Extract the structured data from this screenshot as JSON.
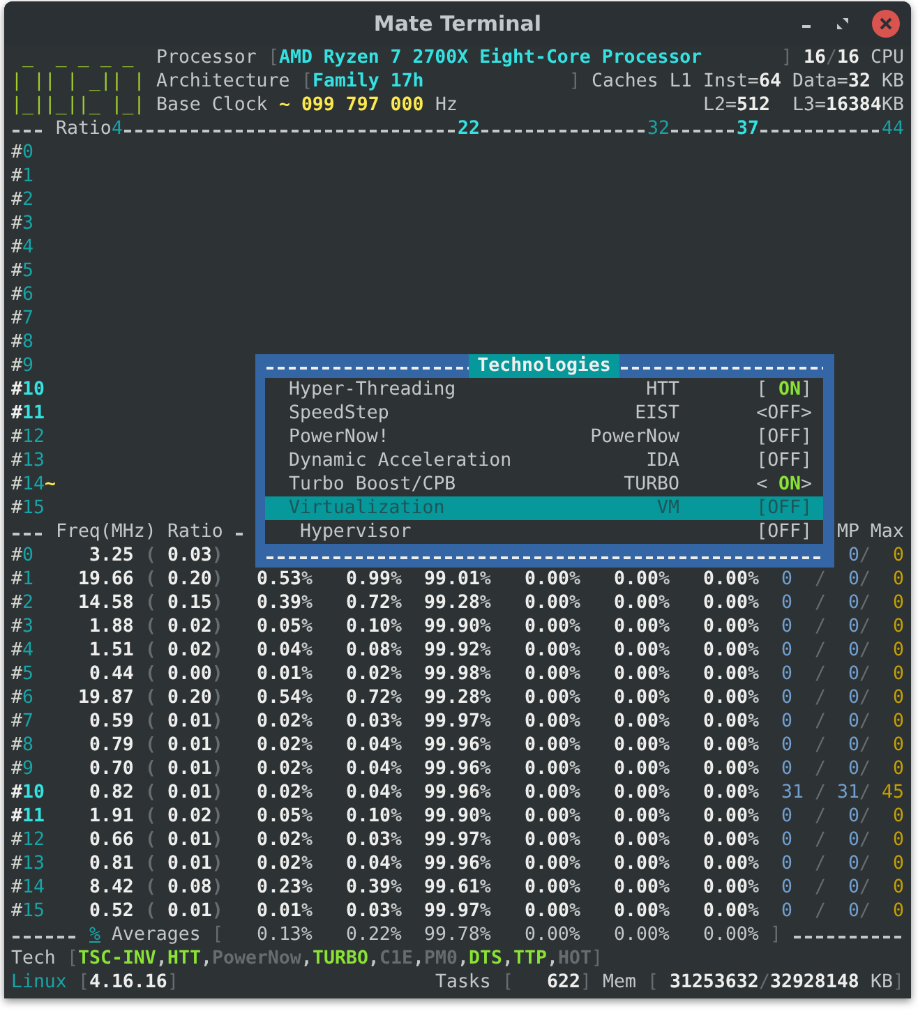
{
  "window": {
    "title": "Mate Terminal"
  },
  "header": {
    "logo": [
      " _  _ _ _ _",
      "| || | _|| |",
      "|_||_||_ |_|"
    ],
    "lines": [
      [
        {
          "text": "Processor",
          "kind": "label"
        },
        {
          "text": "[",
          "kind": "bracket"
        },
        {
          "text": "AMD Ryzen 7 2700X Eight-Core Processor",
          "kind": "value"
        },
        {
          "text": "]",
          "kind": "bracket"
        },
        {
          "text": "16",
          "kind": "number"
        },
        {
          "text": "/",
          "kind": "bracket"
        },
        {
          "text": "16",
          "kind": "number"
        },
        {
          "text": "CPU",
          "kind": "label"
        }
      ],
      [
        {
          "text": "Architecture",
          "kind": "label"
        },
        {
          "text": "[",
          "kind": "bracket"
        },
        {
          "text": "Family 17h",
          "kind": "value"
        },
        {
          "text": "]",
          "kind": "bracket"
        },
        {
          "text": "Caches L1",
          "kind": "label"
        },
        {
          "text": "Inst=",
          "kind": "label"
        },
        {
          "text": "64",
          "kind": "number"
        },
        {
          "text": "Data=",
          "kind": "label"
        },
        {
          "text": "32",
          "kind": "number"
        },
        {
          "text": "KB",
          "kind": "label"
        }
      ],
      [
        {
          "text": "Base Clock",
          "kind": "label"
        },
        {
          "text": "~ 099 797 000",
          "kind": "clock"
        },
        {
          "text": "Hz",
          "kind": "label"
        },
        {
          "text": "L2=",
          "kind": "label"
        },
        {
          "text": "512",
          "kind": "number"
        },
        {
          "text": "L3=",
          "kind": "label"
        },
        {
          "text": "16384",
          "kind": "number"
        },
        {
          "text": "KB",
          "kind": "label"
        }
      ]
    ]
  },
  "ratio_scale": {
    "label": "Ratio",
    "ticks": [
      {
        "text": "4",
        "bright": false
      },
      {
        "text": "22",
        "bright": true
      },
      {
        "text": "32",
        "bright": false
      },
      {
        "text": "37",
        "bright": true
      },
      {
        "text": "44",
        "bright": false
      }
    ]
  },
  "cores": [
    {
      "label": "#0",
      "active": false
    },
    {
      "label": "#1",
      "active": false
    },
    {
      "label": "#2",
      "active": false
    },
    {
      "label": "#3",
      "active": false
    },
    {
      "label": "#4",
      "active": false
    },
    {
      "label": "#5",
      "active": false
    },
    {
      "label": "#6",
      "active": false
    },
    {
      "label": "#7",
      "active": false
    },
    {
      "label": "#8",
      "active": false
    },
    {
      "label": "#9",
      "active": false
    },
    {
      "label": "#10",
      "active": true
    },
    {
      "label": "#11",
      "active": true
    },
    {
      "label": "#12",
      "active": false
    },
    {
      "label": "#13",
      "active": false
    },
    {
      "label": "#14",
      "active": false,
      "marker": "~"
    },
    {
      "label": "#15",
      "active": false
    }
  ],
  "freq_table": {
    "header": {
      "freq": "Freq(MHz)",
      "ratio": "Ratio",
      "tail": "MP Max"
    },
    "rows": [
      {
        "label": "#0",
        "active": false,
        "freq": "3.25",
        "ratio": "( 0.03)",
        "c_states": [
          "0",
          "/",
          "0"
        ]
      },
      {
        "label": "#1",
        "active": false,
        "freq": "19.66",
        "ratio": "( 0.20)",
        "load": [
          "0.53%",
          "0.99%",
          "99.01%",
          "0.00%",
          "0.00%",
          "0.00%"
        ],
        "c_states": [
          "0",
          "/",
          "0",
          "/",
          "0"
        ]
      },
      {
        "label": "#2",
        "active": false,
        "freq": "14.58",
        "ratio": "( 0.15)",
        "load": [
          "0.39%",
          "0.72%",
          "99.28%",
          "0.00%",
          "0.00%",
          "0.00%"
        ],
        "c_states": [
          "0",
          "/",
          "0",
          "/",
          "0"
        ]
      },
      {
        "label": "#3",
        "active": false,
        "freq": "1.88",
        "ratio": "( 0.02)",
        "load": [
          "0.05%",
          "0.10%",
          "99.90%",
          "0.00%",
          "0.00%",
          "0.00%"
        ],
        "c_states": [
          "0",
          "/",
          "0",
          "/",
          "0"
        ]
      },
      {
        "label": "#4",
        "active": false,
        "freq": "1.51",
        "ratio": "( 0.02)",
        "load": [
          "0.04%",
          "0.08%",
          "99.92%",
          "0.00%",
          "0.00%",
          "0.00%"
        ],
        "c_states": [
          "0",
          "/",
          "0",
          "/",
          "0"
        ]
      },
      {
        "label": "#5",
        "active": false,
        "freq": "0.44",
        "ratio": "( 0.00)",
        "load": [
          "0.01%",
          "0.02%",
          "99.98%",
          "0.00%",
          "0.00%",
          "0.00%"
        ],
        "c_states": [
          "0",
          "/",
          "0",
          "/",
          "0"
        ]
      },
      {
        "label": "#6",
        "active": false,
        "freq": "19.87",
        "ratio": "( 0.20)",
        "load": [
          "0.54%",
          "0.72%",
          "99.28%",
          "0.00%",
          "0.00%",
          "0.00%"
        ],
        "c_states": [
          "0",
          "/",
          "0",
          "/",
          "0"
        ]
      },
      {
        "label": "#7",
        "active": false,
        "freq": "0.59",
        "ratio": "( 0.01)",
        "load": [
          "0.02%",
          "0.03%",
          "99.97%",
          "0.00%",
          "0.00%",
          "0.00%"
        ],
        "c_states": [
          "0",
          "/",
          "0",
          "/",
          "0"
        ]
      },
      {
        "label": "#8",
        "active": false,
        "freq": "0.79",
        "ratio": "( 0.01)",
        "load": [
          "0.02%",
          "0.04%",
          "99.96%",
          "0.00%",
          "0.00%",
          "0.00%"
        ],
        "c_states": [
          "0",
          "/",
          "0",
          "/",
          "0"
        ]
      },
      {
        "label": "#9",
        "active": false,
        "freq": "0.70",
        "ratio": "( 0.01)",
        "load": [
          "0.02%",
          "0.04%",
          "99.96%",
          "0.00%",
          "0.00%",
          "0.00%"
        ],
        "c_states": [
          "0",
          "/",
          "0",
          "/",
          "0"
        ]
      },
      {
        "label": "#10",
        "active": true,
        "freq": "0.82",
        "ratio": "( 0.01)",
        "load": [
          "0.02%",
          "0.04%",
          "99.96%",
          "0.00%",
          "0.00%",
          "0.00%"
        ],
        "c_states": [
          "31",
          "/",
          "31",
          "/",
          "45"
        ]
      },
      {
        "label": "#11",
        "active": true,
        "freq": "1.91",
        "ratio": "( 0.02)",
        "load": [
          "0.05%",
          "0.10%",
          "99.90%",
          "0.00%",
          "0.00%",
          "0.00%"
        ],
        "c_states": [
          "0",
          "/",
          "0",
          "/",
          "0"
        ]
      },
      {
        "label": "#12",
        "active": false,
        "freq": "0.66",
        "ratio": "( 0.01)",
        "load": [
          "0.02%",
          "0.03%",
          "99.97%",
          "0.00%",
          "0.00%",
          "0.00%"
        ],
        "c_states": [
          "0",
          "/",
          "0",
          "/",
          "0"
        ]
      },
      {
        "label": "#13",
        "active": false,
        "freq": "0.81",
        "ratio": "( 0.01)",
        "load": [
          "0.02%",
          "0.04%",
          "99.96%",
          "0.00%",
          "0.00%",
          "0.00%"
        ],
        "c_states": [
          "0",
          "/",
          "0",
          "/",
          "0"
        ]
      },
      {
        "label": "#14",
        "active": false,
        "freq": "8.42",
        "ratio": "( 0.08)",
        "load": [
          "0.23%",
          "0.39%",
          "99.61%",
          "0.00%",
          "0.00%",
          "0.00%"
        ],
        "c_states": [
          "0",
          "/",
          "0",
          "/",
          "0"
        ]
      },
      {
        "label": "#15",
        "active": false,
        "freq": "0.52",
        "ratio": "( 0.01)",
        "load": [
          "0.01%",
          "0.03%",
          "99.97%",
          "0.00%",
          "0.00%",
          "0.00%"
        ],
        "c_states": [
          "0",
          "/",
          "0",
          "/",
          "0"
        ]
      }
    ],
    "averages": {
      "toggle": "%",
      "label": "Averages",
      "open": "[",
      "load": [
        "0.13%",
        "0.22%",
        "99.78%",
        "0.00%",
        "0.00%",
        "0.00%"
      ],
      "close": "]"
    }
  },
  "tech": {
    "label": "Tech",
    "open": "[",
    "features": [
      {
        "name": "TSC-INV,",
        "on": true
      },
      {
        "name": "HTT,",
        "on": true
      },
      {
        "name": "PowerNow,",
        "on": false
      },
      {
        "name": "TURBO,",
        "on": true
      },
      {
        "name": "C1E,",
        "on": false
      },
      {
        "name": "PM0,",
        "on": false
      },
      {
        "name": "DTS,",
        "on": true
      },
      {
        "name": "TTP,",
        "on": true
      },
      {
        "name": "HOT",
        "on": false
      }
    ],
    "close": "]"
  },
  "system": [
    {
      "text": "Linux",
      "kind": "os"
    },
    {
      "text": "[",
      "kind": "bracket"
    },
    {
      "text": "4.16.16",
      "kind": "number"
    },
    {
      "text": "]",
      "kind": "bracket"
    },
    {
      "text": "Tasks",
      "kind": "label"
    },
    {
      "text": "[",
      "kind": "bracket"
    },
    {
      "text": "622",
      "kind": "number"
    },
    {
      "text": "]",
      "kind": "bracket"
    },
    {
      "text": "Mem",
      "kind": "label"
    },
    {
      "text": "[",
      "kind": "bracket"
    },
    {
      "text": "31253632",
      "kind": "number"
    },
    {
      "text": "/",
      "kind": "bracket"
    },
    {
      "text": "32928148",
      "kind": "number"
    },
    {
      "text": "KB",
      "kind": "label"
    },
    {
      "text": "]",
      "kind": "bracket"
    }
  ],
  "technologies_dialog": {
    "title": "Technologies",
    "items": [
      {
        "label": "Hyper-Threading",
        "code": "HTT",
        "status": "[ ON]",
        "on": true,
        "selected": false
      },
      {
        "label": "SpeedStep",
        "code": "EIST",
        "status": "<OFF>",
        "on": false,
        "selected": false
      },
      {
        "label": "PowerNow!",
        "code": "PowerNow",
        "status": "[OFF]",
        "on": false,
        "selected": false
      },
      {
        "label": "Dynamic Acceleration",
        "code": "IDA",
        "status": "[OFF]",
        "on": false,
        "selected": false
      },
      {
        "label": "Turbo Boost/CPB",
        "code": "TURBO",
        "status": "< ON>",
        "on": true,
        "selected": false
      },
      {
        "label": "Virtualization",
        "code": "VM",
        "status": "[OFF]",
        "on": false,
        "selected": true,
        "children": [
          {
            "label": "Hypervisor",
            "status": "[OFF]",
            "on": false,
            "selected": false
          }
        ]
      }
    ]
  }
}
